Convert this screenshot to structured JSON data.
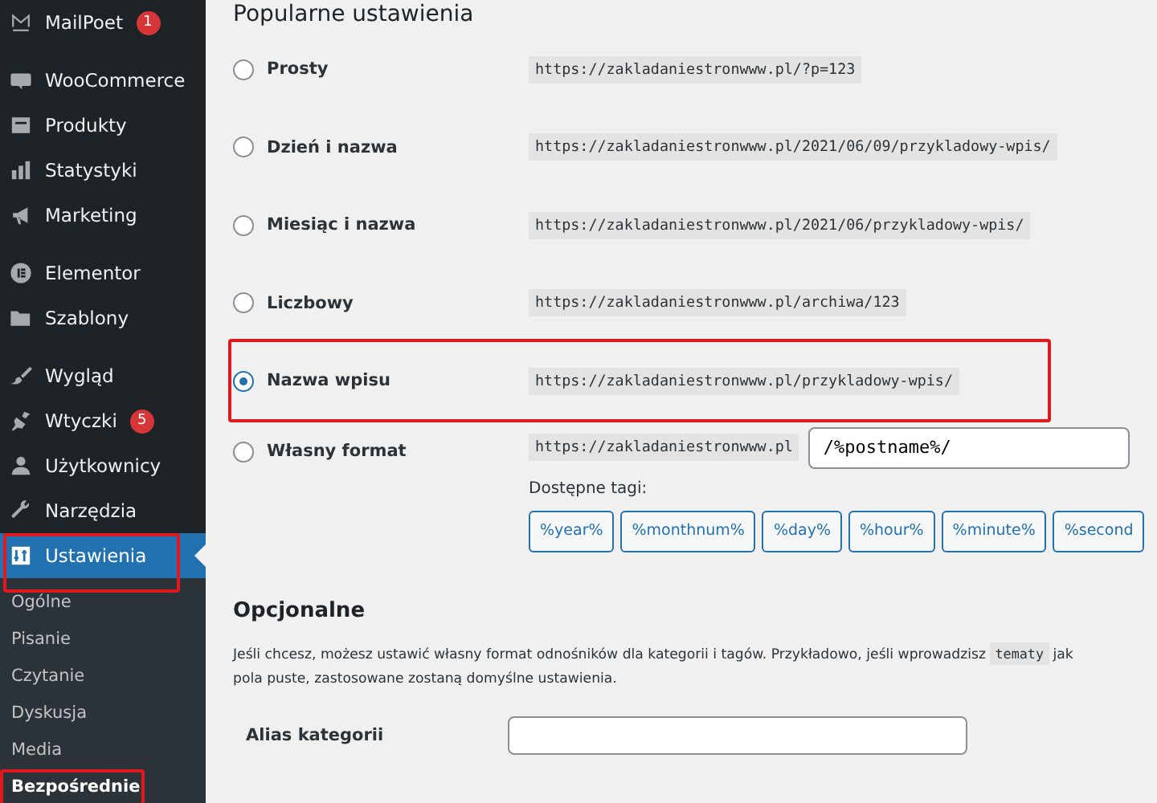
{
  "sidebar": {
    "groups": [
      [
        {
          "label": "MailPoet",
          "kind": "mailpoet",
          "badge": "1",
          "current": false,
          "highlighted": false
        }
      ],
      [
        {
          "label": "WooCommerce",
          "kind": "woo",
          "current": false,
          "highlighted": false
        },
        {
          "label": "Produkty",
          "kind": "box",
          "current": false,
          "highlighted": false
        },
        {
          "label": "Statystyki",
          "kind": "bars",
          "current": false,
          "highlighted": false
        },
        {
          "label": "Marketing",
          "kind": "megaphone",
          "current": false,
          "highlighted": false
        }
      ],
      [
        {
          "label": "Elementor",
          "kind": "elementor",
          "current": false,
          "highlighted": false
        },
        {
          "label": "Szablony",
          "kind": "folder",
          "current": false,
          "highlighted": false
        }
      ],
      [
        {
          "label": "Wygląd",
          "kind": "brush",
          "current": false,
          "highlighted": false
        },
        {
          "label": "Wtyczki",
          "kind": "plug",
          "badge": "5",
          "current": false,
          "highlighted": false
        },
        {
          "label": "Użytkownicy",
          "kind": "user",
          "current": false,
          "highlighted": false
        },
        {
          "label": "Narzędzia",
          "kind": "wrench",
          "current": false,
          "highlighted": false
        },
        {
          "label": "Ustawienia",
          "kind": "settings",
          "current": true,
          "highlighted": true
        }
      ]
    ],
    "submenu": [
      {
        "label": "Ogólne",
        "selected": false,
        "highlighted": false
      },
      {
        "label": "Pisanie",
        "selected": false,
        "highlighted": false
      },
      {
        "label": "Czytanie",
        "selected": false,
        "highlighted": false
      },
      {
        "label": "Dyskusja",
        "selected": false,
        "highlighted": false
      },
      {
        "label": "Media",
        "selected": false,
        "highlighted": false
      },
      {
        "label": "Bezpośrednie",
        "selected": true,
        "highlighted": true
      }
    ]
  },
  "common": {
    "heading": "Popularne ustawienia",
    "options": [
      {
        "label": "Prosty",
        "example": "https://zakladaniestronwww.pl/?p=123",
        "selected": false,
        "highlighted": false
      },
      {
        "label": "Dzień i nazwa",
        "example": "https://zakladaniestronwww.pl/2021/06/09/przykladowy-wpis/",
        "selected": false,
        "highlighted": false
      },
      {
        "label": "Miesiąc i nazwa",
        "example": "https://zakladaniestronwww.pl/2021/06/przykladowy-wpis/",
        "selected": false,
        "highlighted": false
      },
      {
        "label": "Liczbowy",
        "example": "https://zakladaniestronwww.pl/archiwa/123",
        "selected": false,
        "highlighted": false
      },
      {
        "label": "Nazwa wpisu",
        "example": "https://zakladaniestronwww.pl/przykladowy-wpis/",
        "selected": true,
        "highlighted": true
      }
    ],
    "custom": {
      "label": "Własny format",
      "prefix": "https://zakladaniestronwww.pl",
      "value": "/%postname%/",
      "selected": false,
      "tags_label": "Dostępne tagi:",
      "tags": [
        "%year%",
        "%monthnum%",
        "%day%",
        "%hour%",
        "%minute%",
        "%second"
      ]
    }
  },
  "optional": {
    "heading": "Opcjonalne",
    "line1": "Jeśli chcesz, możesz ustawić własny format odnośników dla kategorii i tagów. Przykładowo, jeśli wprowadzisz",
    "code": "tematy",
    "line1_end": "jak",
    "line2": "pola puste, zastosowane zostaną domyślne ustawienia.",
    "fields": [
      {
        "label": "Alias kategorii"
      }
    ]
  }
}
